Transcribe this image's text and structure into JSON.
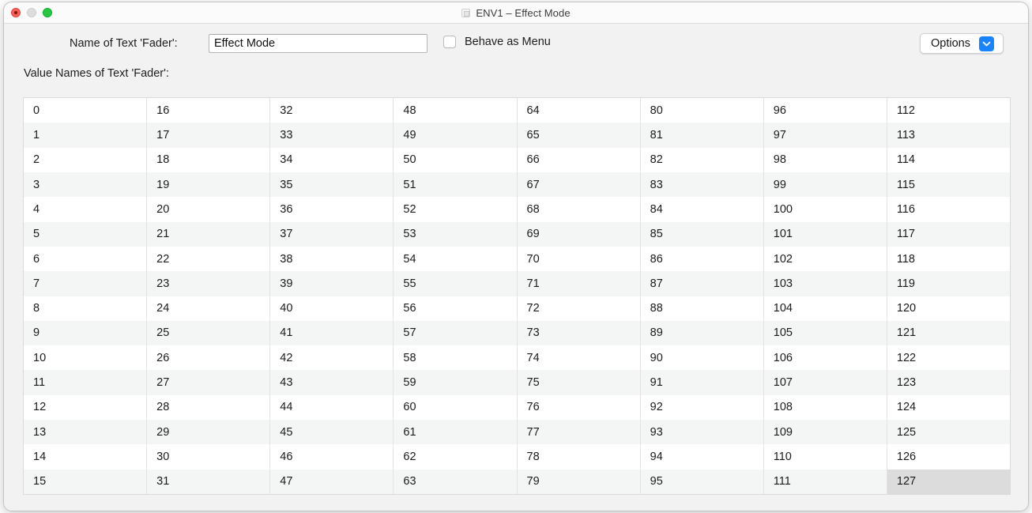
{
  "window": {
    "title": "ENV1 – Effect Mode",
    "doc_icon": "document-icon",
    "traffic_lights": {
      "close": "close-button",
      "minimize": "minimize-button",
      "zoom": "zoom-button"
    }
  },
  "form": {
    "name_label": "Name of Text 'Fader':",
    "name_value": "Effect Mode",
    "name_placeholder": "",
    "behave_as_menu_label": "Behave as Menu",
    "behave_as_menu_checked": false,
    "options_label": "Options",
    "options_chevron_icon": "chevron-down-icon",
    "options_accent_color": "#1a84ff"
  },
  "table": {
    "label": "Value Names of Text 'Fader':",
    "rows": 16,
    "columns": 8,
    "selected_value": "127",
    "columns_data": [
      [
        "0",
        "1",
        "2",
        "3",
        "4",
        "5",
        "6",
        "7",
        "8",
        "9",
        "10",
        "11",
        "12",
        "13",
        "14",
        "15"
      ],
      [
        "16",
        "17",
        "18",
        "19",
        "20",
        "21",
        "22",
        "23",
        "24",
        "25",
        "26",
        "27",
        "28",
        "29",
        "30",
        "31"
      ],
      [
        "32",
        "33",
        "34",
        "35",
        "36",
        "37",
        "38",
        "39",
        "40",
        "41",
        "42",
        "43",
        "44",
        "45",
        "46",
        "47"
      ],
      [
        "48",
        "49",
        "50",
        "51",
        "52",
        "53",
        "54",
        "55",
        "56",
        "57",
        "58",
        "59",
        "60",
        "61",
        "62",
        "63"
      ],
      [
        "64",
        "65",
        "66",
        "67",
        "68",
        "69",
        "70",
        "71",
        "72",
        "73",
        "74",
        "75",
        "76",
        "77",
        "78",
        "79"
      ],
      [
        "80",
        "81",
        "82",
        "83",
        "84",
        "85",
        "86",
        "87",
        "88",
        "89",
        "90",
        "91",
        "92",
        "93",
        "94",
        "95"
      ],
      [
        "96",
        "97",
        "98",
        "99",
        "100",
        "101",
        "102",
        "103",
        "104",
        "105",
        "106",
        "107",
        "108",
        "109",
        "110",
        "111"
      ],
      [
        "112",
        "113",
        "114",
        "115",
        "116",
        "117",
        "118",
        "119",
        "120",
        "121",
        "122",
        "123",
        "124",
        "125",
        "126",
        "127"
      ]
    ]
  }
}
